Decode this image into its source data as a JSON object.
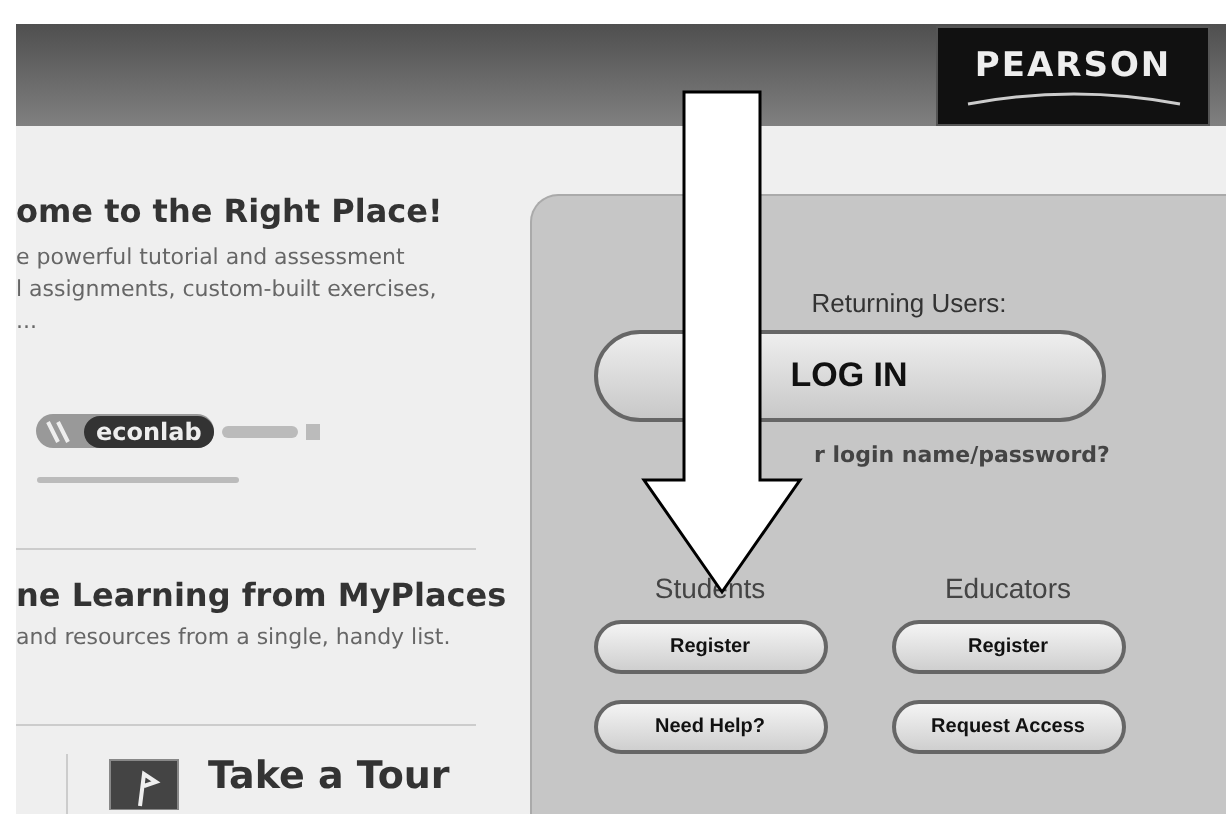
{
  "header": {
    "logo": "PEARSON"
  },
  "intro": {
    "heading": "ome to the Right Place!",
    "lines": [
      "e powerful tutorial and assessment",
      "l assignments, custom-built exercises,",
      "..."
    ],
    "logo": "econlab"
  },
  "myplaces": {
    "heading": "ne Learning from MyPlaces",
    "text": "and resources from a single, handy list."
  },
  "tour": {
    "label": "Take a Tour"
  },
  "login_panel": {
    "prompt": "Returning Users:",
    "login_button": "LOG IN",
    "forgot_link": "r login name/password?",
    "groups": [
      {
        "title": "Students",
        "buttons": [
          "Register",
          "Need Help?"
        ]
      },
      {
        "title": "Educators",
        "buttons": [
          "Register",
          "Request Access"
        ]
      }
    ]
  }
}
